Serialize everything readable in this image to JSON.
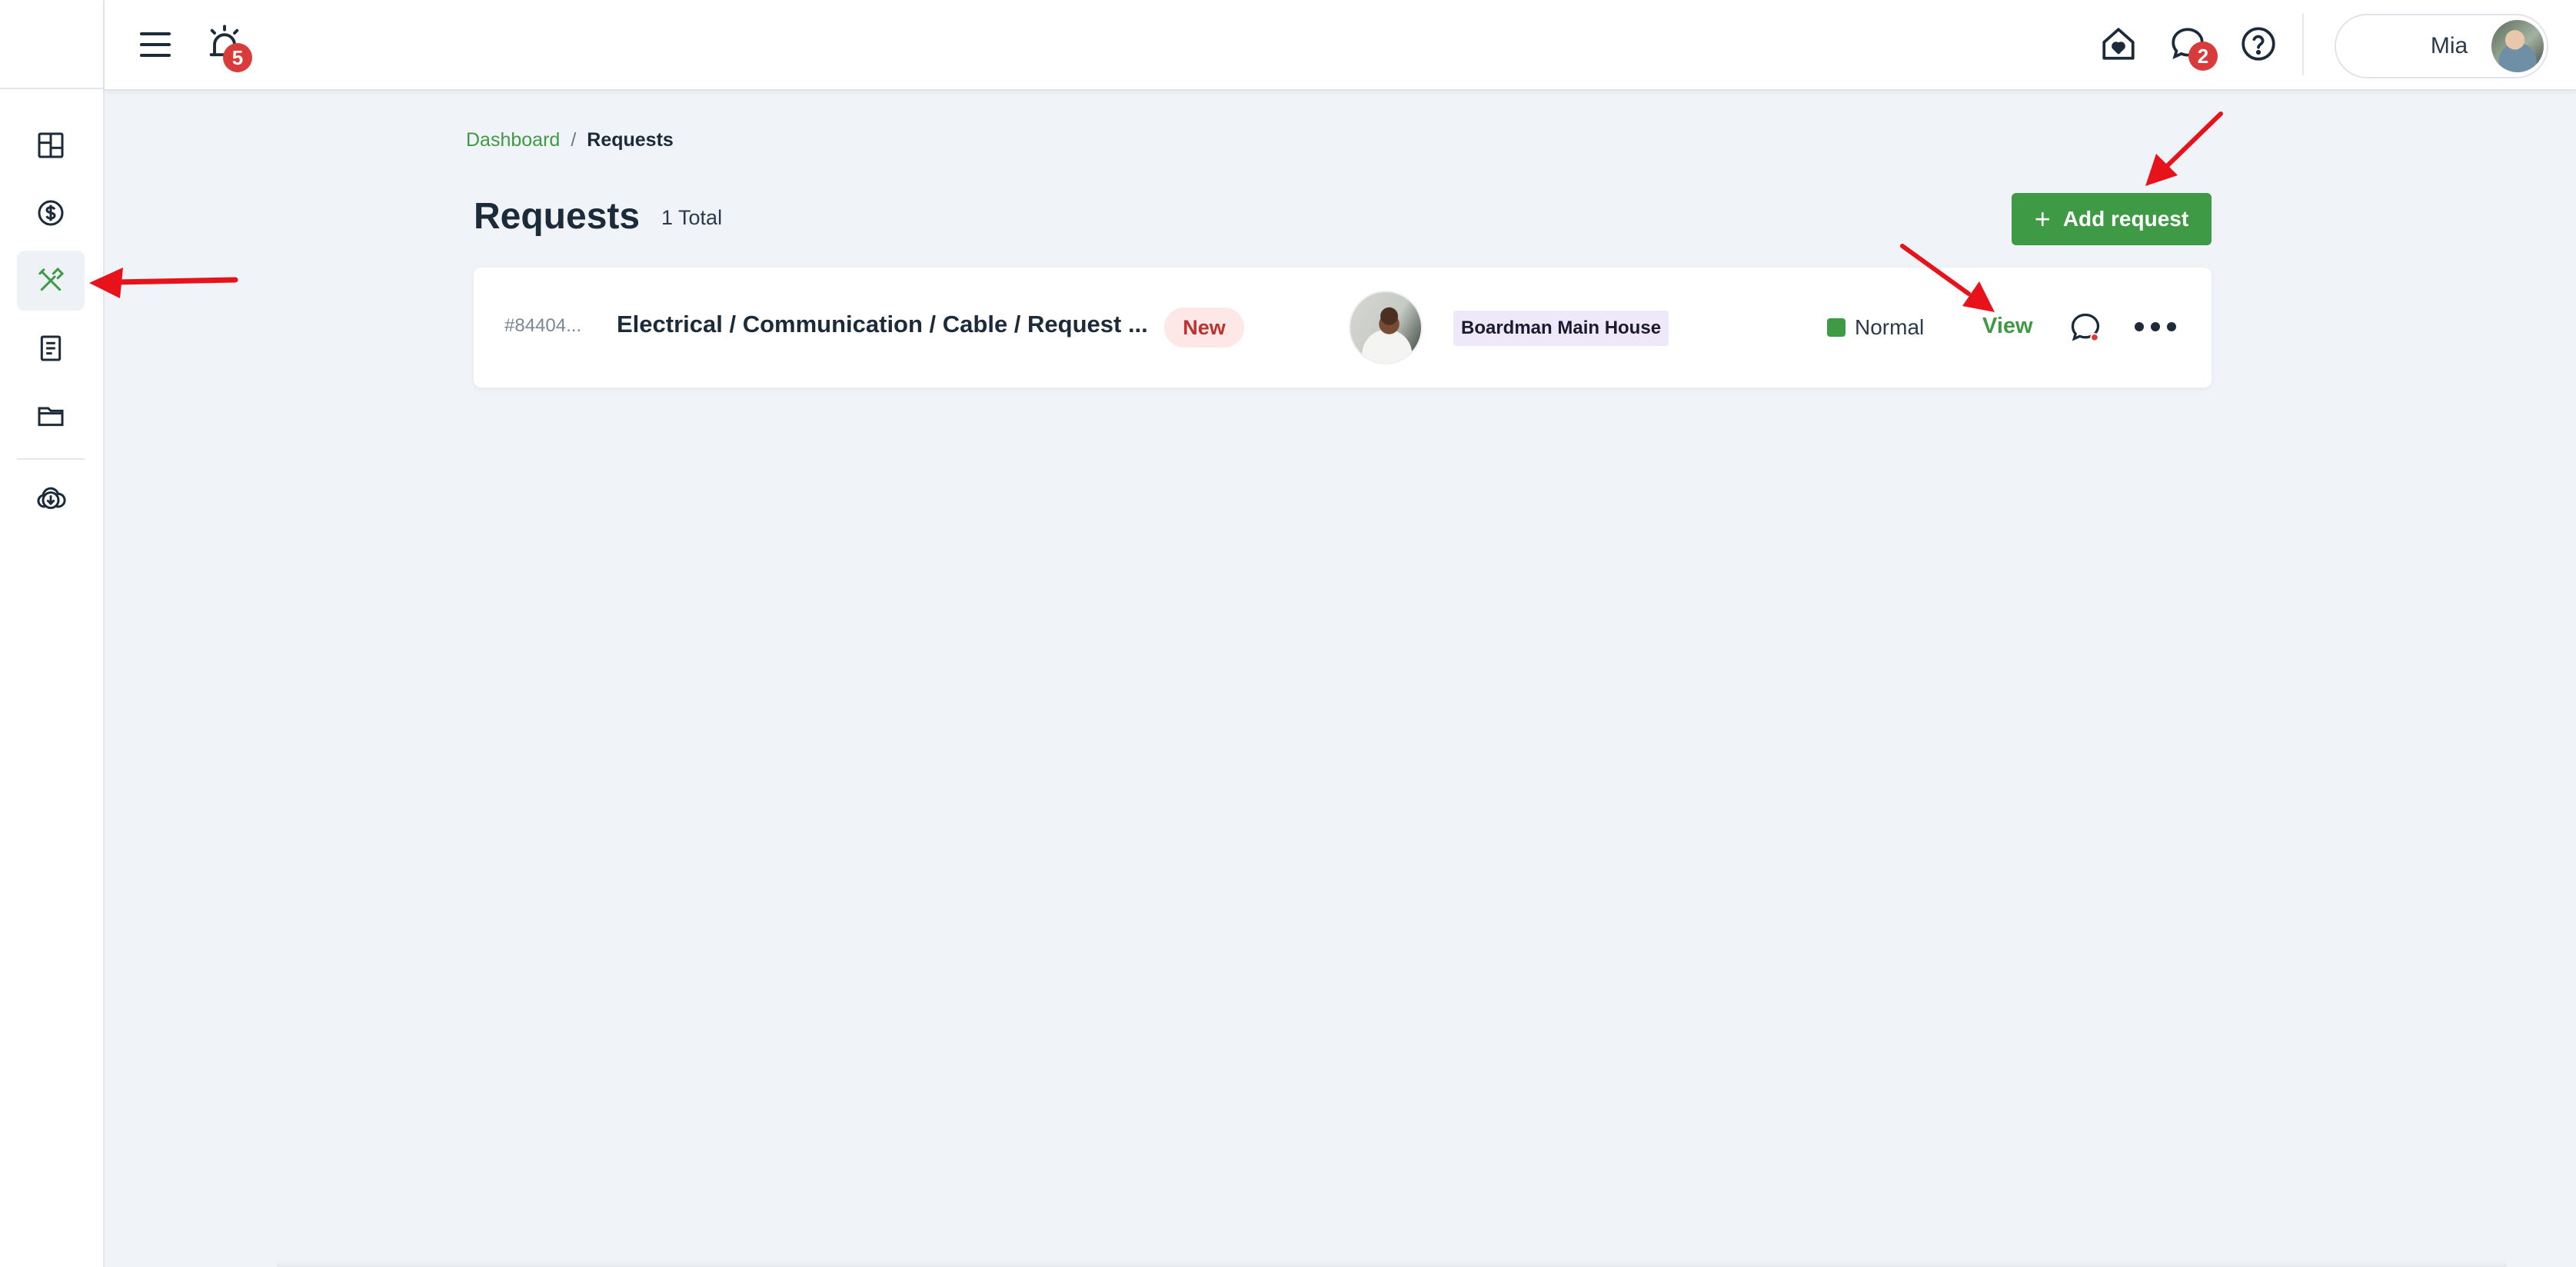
{
  "app": {
    "colors": {
      "accent": "#3f9a45",
      "badge": "#d93b3b",
      "status_new_bg": "#fde7e7",
      "status_new_text": "#c0302e",
      "property_tag_bg": "#efe8fb",
      "annotation": "#e8121a"
    }
  },
  "sidebar": {
    "items": [
      {
        "icon": "dashboard-grid-icon",
        "active": false
      },
      {
        "icon": "dollar-circle-icon",
        "active": false
      },
      {
        "icon": "tools-icon",
        "active": true
      },
      {
        "icon": "document-icon",
        "active": false
      },
      {
        "icon": "folder-icon",
        "active": false
      },
      {
        "icon": "cloud-download-icon",
        "active": false
      }
    ]
  },
  "topbar": {
    "menu_icon": "hamburger-menu-icon",
    "alarm_icon": "alarm-icon",
    "alarm_badge": "5",
    "home_icon": "home-heart-icon",
    "messages_icon": "chat-bubble-icon",
    "messages_badge": "2",
    "help_icon": "help-circle-icon",
    "user_name": "Mia"
  },
  "breadcrumb": {
    "link": "Dashboard",
    "separator": "/",
    "current": "Requests"
  },
  "page": {
    "title": "Requests",
    "total": "1 Total",
    "add_button_plus": "+",
    "add_button_label": "Add request"
  },
  "requests": [
    {
      "id": "#84404...",
      "title": "Electrical / Communication / Cable / Request ...",
      "status": "New",
      "property": "Boardman Main House",
      "priority": "Normal",
      "view_label": "View"
    }
  ]
}
